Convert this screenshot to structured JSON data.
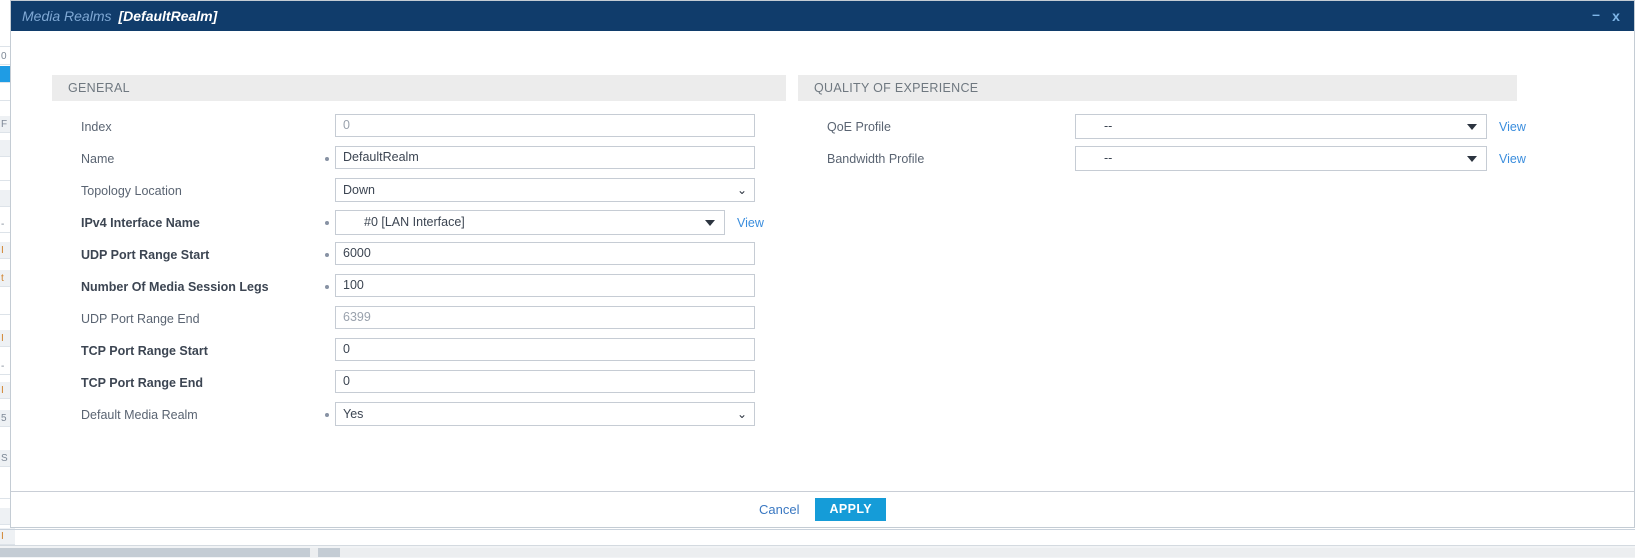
{
  "window": {
    "title_main": "Media Realms",
    "title_sub": "[DefaultRealm]",
    "minimize_label": "–",
    "close_label": "x",
    "titlebar_color": "#103c6b",
    "accent_color": "#159cd8",
    "link_color": "#3a8ddd"
  },
  "sections": {
    "general": {
      "header": "GENERAL",
      "rows": [
        {
          "label": "Index",
          "value": "0",
          "control": "text",
          "required": false,
          "bold": false,
          "readonly": true
        },
        {
          "label": "Name",
          "value": "DefaultRealm",
          "control": "text",
          "required": true,
          "bold": false,
          "readonly": false
        },
        {
          "label": "Topology Location",
          "value": "Down",
          "control": "select",
          "required": false,
          "bold": false,
          "readonly": false
        },
        {
          "label": "IPv4 Interface Name",
          "value": "#0 [LAN Interface]",
          "control": "dropdown",
          "required": true,
          "bold": true,
          "readonly": false,
          "view": "View"
        },
        {
          "label": "UDP Port Range Start",
          "value": "6000",
          "control": "text",
          "required": true,
          "bold": true,
          "readonly": false
        },
        {
          "label": "Number Of Media Session Legs",
          "value": "100",
          "control": "text",
          "required": true,
          "bold": true,
          "readonly": false
        },
        {
          "label": "UDP Port Range End",
          "value": "6399",
          "control": "text",
          "required": false,
          "bold": false,
          "readonly": true
        },
        {
          "label": "TCP Port Range Start",
          "value": "0",
          "control": "text",
          "required": false,
          "bold": true,
          "readonly": false
        },
        {
          "label": "TCP Port Range End",
          "value": "0",
          "control": "text",
          "required": false,
          "bold": true,
          "readonly": false
        },
        {
          "label": "Default Media Realm",
          "value": "Yes",
          "control": "select",
          "required": true,
          "bold": false,
          "readonly": false
        }
      ]
    },
    "quality_of_experience": {
      "header": "QUALITY OF EXPERIENCE",
      "rows": [
        {
          "label": "QoE Profile",
          "value": "--",
          "control": "dropdown",
          "required": false,
          "bold": false,
          "readonly": false,
          "view": "View"
        },
        {
          "label": "Bandwidth Profile",
          "value": "--",
          "control": "dropdown",
          "required": false,
          "bold": false,
          "readonly": false,
          "view": "View"
        }
      ]
    }
  },
  "footer": {
    "cancel_label": "Cancel",
    "apply_label": "APPLY"
  }
}
